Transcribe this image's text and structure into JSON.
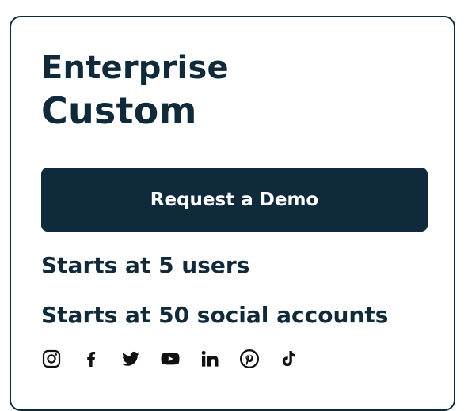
{
  "plan": {
    "name": "Enterprise",
    "price": "Custom"
  },
  "cta": {
    "label": "Request a Demo"
  },
  "features": [
    "Starts at 5 users",
    "Starts at 50 social accounts"
  ],
  "social_links": [
    {
      "icon": "instagram-icon"
    },
    {
      "icon": "facebook-icon"
    },
    {
      "icon": "twitter-icon"
    },
    {
      "icon": "youtube-icon"
    },
    {
      "icon": "linkedin-icon"
    },
    {
      "icon": "pinterest-icon"
    },
    {
      "icon": "tiktok-icon"
    }
  ],
  "colors": {
    "primary": "#0f2a3a",
    "text": "#102a3a",
    "background": "#ffffff",
    "icon": "#111111"
  }
}
